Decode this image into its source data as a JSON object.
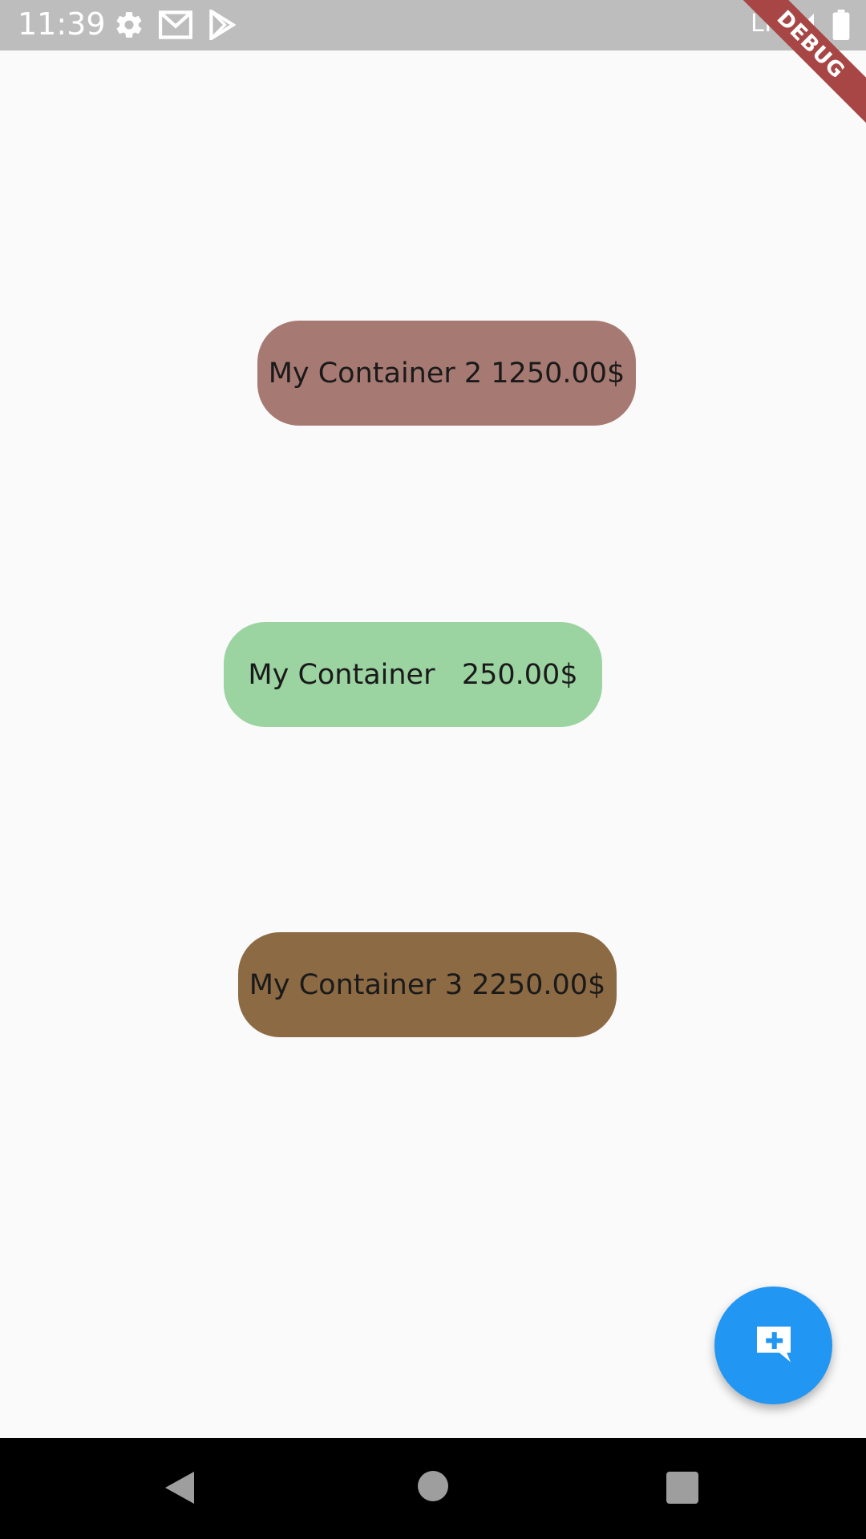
{
  "status_bar": {
    "time": "11:39",
    "network": "LTE",
    "icons": [
      "settings-icon",
      "gmail-icon",
      "play-store-icon",
      "signal-icon",
      "battery-icon"
    ]
  },
  "debug_banner": "DEBUG",
  "containers": [
    {
      "label": "My Container 2 1250.00$",
      "color": "#a67a72"
    },
    {
      "label": "My Container   250.00$",
      "color": "#9bd3a1"
    },
    {
      "label": "My Container 3 2250.00$",
      "color": "#8c6a44"
    }
  ],
  "fab": {
    "icon": "add-comment-icon",
    "color": "#2196f3"
  },
  "nav_bar": {
    "buttons": [
      "back-icon",
      "home-icon",
      "recents-icon"
    ]
  }
}
